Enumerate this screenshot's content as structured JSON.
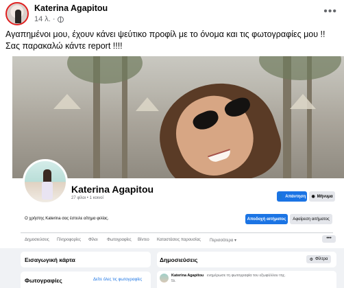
{
  "post": {
    "author": "Katerina Agapitou",
    "time": "14 λ.",
    "dots": "•••",
    "text": "Αγαπημένοι μου, έχουν κάνει ψεύτικο προφίλ με το όνομα και τις φωτογραφίες μου !! Σας παρακαλώ κάντε report !!!!"
  },
  "profile": {
    "name": "Katerina Agapitou",
    "friends": "27 φίλοι • 1 κοινοί",
    "respond_button": "Απάντηση",
    "message_button": "Μήνυμα"
  },
  "friend_request": {
    "text": "Ο χρήστης Katerina σας έστειλε αίτημα φιλίας.",
    "accept_button": "Αποδοχή αιτήματος",
    "remove_button": "Αφαίρεση αιτήματος"
  },
  "tabs": [
    "Δημοσιεύσεις",
    "Πληροφορίες",
    "Φίλοι",
    "Φωτογραφίες",
    "Βίντεο",
    "Καταστάσεις παρουσίας",
    "Περισσότερα ▾"
  ],
  "more_dots": "•••",
  "intro": {
    "title": "Εισαγωγική κάρτα"
  },
  "photos": {
    "title": "Φωτογραφίες",
    "link": "Δείτε όλες τις φωτογραφίες"
  },
  "posts": {
    "title": "Δημοσιεύσεις",
    "filter_button": "Φίλτρα",
    "item_author": "Katerina Agapitou",
    "item_text": "ενημέρωσε τη φωτογραφία του εξωφύλλου της.",
    "item_time": "5λ."
  },
  "colors": {
    "accent": "#1b74e4",
    "background": "#f0f2f5",
    "text": "#050505",
    "secondary_text": "#65676b"
  }
}
